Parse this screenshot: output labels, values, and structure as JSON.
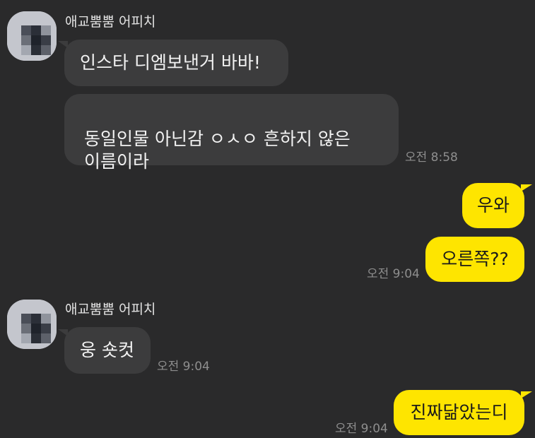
{
  "chat": {
    "groups": [
      {
        "sender": "애교뿜뿜 어피치",
        "messages": [
          {
            "text": "인스타 디엠보낸거 바바!"
          },
          {
            "text": "동일인물 아닌감 ㅇㅅㅇ 흔하지 않은\n이름이라",
            "time": "오전 8:58"
          }
        ]
      },
      {
        "direction": "out",
        "messages": [
          {
            "text": "우와"
          },
          {
            "text": "오른쪽??",
            "time": "오전 9:04"
          }
        ]
      },
      {
        "sender": "애교뿜뿜 어피치",
        "messages": [
          {
            "text": "웅 숏컷",
            "time": "오전 9:04"
          }
        ]
      },
      {
        "direction": "out",
        "messages": [
          {
            "text": "진짜닮았는디",
            "time": "오전 9:04"
          }
        ]
      }
    ]
  },
  "colors": {
    "background": "#2a2a2b",
    "incoming_bubble": "#3c3c3d",
    "outgoing_bubble": "#fee500",
    "incoming_text": "#f2f2f2",
    "outgoing_text": "#1a1a1a",
    "sender_name": "#e3e3e3",
    "timestamp": "#8e8e8e"
  },
  "icons": {
    "avatar": "pixelated-profile-photo"
  }
}
